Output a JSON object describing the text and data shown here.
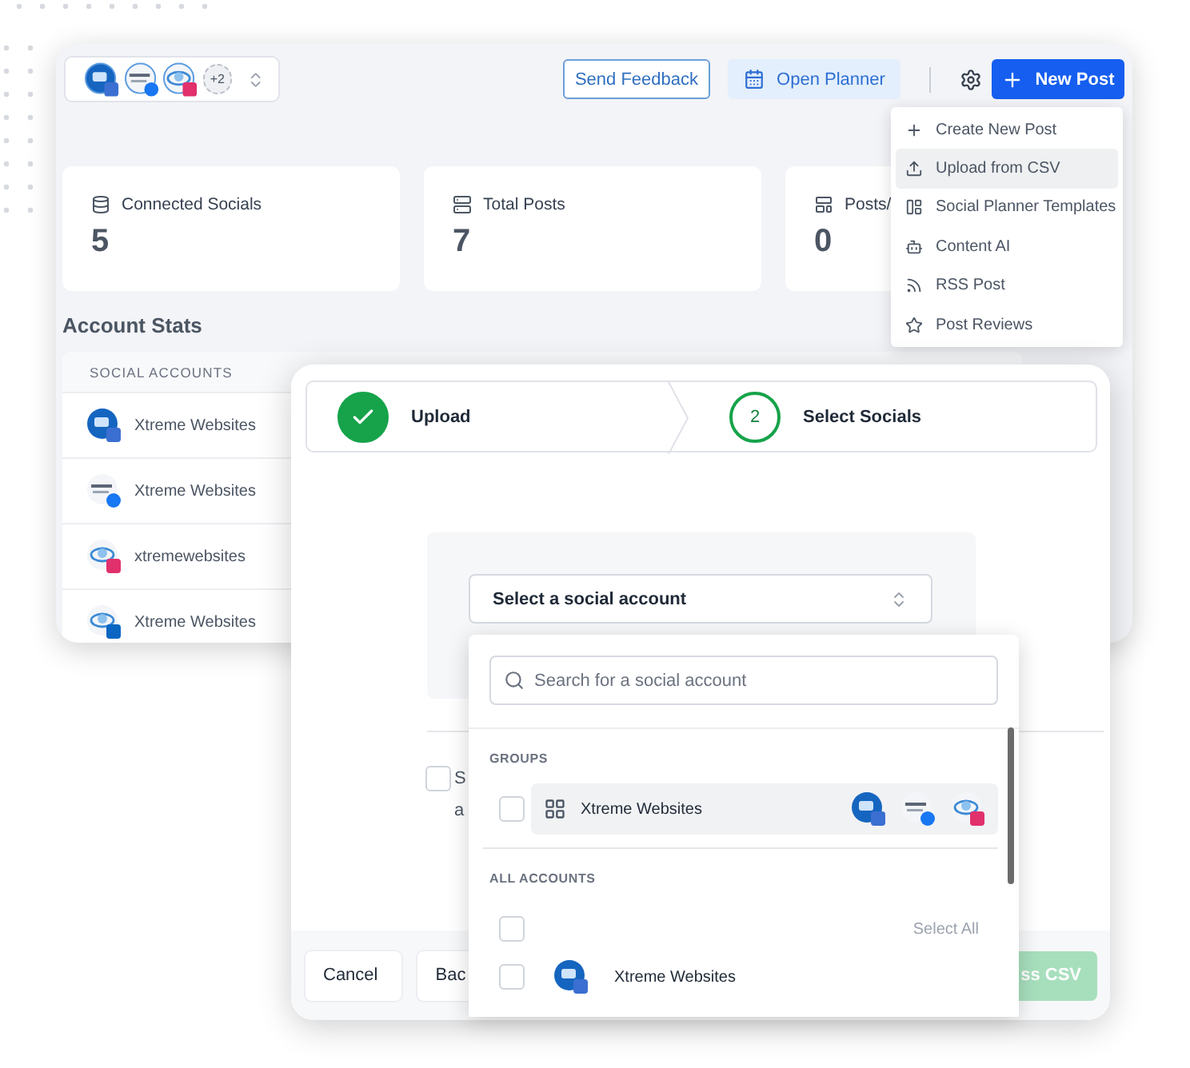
{
  "toolbar": {
    "avatars": [
      {
        "kind": "gmb"
      },
      {
        "kind": "facebook"
      },
      {
        "kind": "instagram"
      }
    ],
    "more_count": "+2",
    "send_feedback": "Send Feedback",
    "open_planner": "Open Planner",
    "new_post": "New Post"
  },
  "new_post_menu": [
    {
      "label": "Create New Post",
      "selected": false
    },
    {
      "label": "Upload from CSV",
      "selected": true
    },
    {
      "label": "Social Planner Templates",
      "selected": false
    },
    {
      "label": "Content AI",
      "selected": false
    },
    {
      "label": "RSS Post",
      "selected": false
    },
    {
      "label": "Post Reviews",
      "selected": false
    }
  ],
  "stats": [
    {
      "label": "Connected Socials",
      "value": "5"
    },
    {
      "label": "Total Posts",
      "value": "7"
    },
    {
      "label": "Posts/",
      "value": "0"
    }
  ],
  "account_stats": {
    "title": "Account Stats",
    "column": "SOCIAL ACCOUNTS",
    "rows": [
      {
        "name": "Xtreme Websites",
        "kind": "gmb"
      },
      {
        "name": "Xtreme Websites",
        "kind": "facebook"
      },
      {
        "name": "xtremewebsites",
        "kind": "instagram"
      },
      {
        "name": "Xtreme Websites",
        "kind": "linkedin"
      }
    ]
  },
  "dialog": {
    "steps": [
      {
        "label": "Upload",
        "done": true
      },
      {
        "label": "Select Socials",
        "done": false,
        "number": "2"
      }
    ],
    "select": {
      "label": "Select a social account"
    },
    "consent": {
      "checked": false,
      "text": "S a"
    },
    "footer": {
      "cancel": "Cancel",
      "back": "Bac",
      "process": "ss CSV",
      "process_disabled": true
    }
  },
  "popover": {
    "search": {
      "placeholder": "Search for a social account"
    },
    "groups_heading": "GROUPS",
    "groups": [
      {
        "name": "Xtreme Websites",
        "checked": false,
        "avatars": [
          {
            "kind": "gmb"
          },
          {
            "kind": "facebook"
          },
          {
            "kind": "instagram"
          }
        ]
      }
    ],
    "all_heading": "ALL ACCOUNTS",
    "select_all": {
      "label": "Select All",
      "checked": false
    },
    "accounts": [
      {
        "name": "Xtreme Websites",
        "kind": "gmb",
        "checked": false
      }
    ]
  }
}
